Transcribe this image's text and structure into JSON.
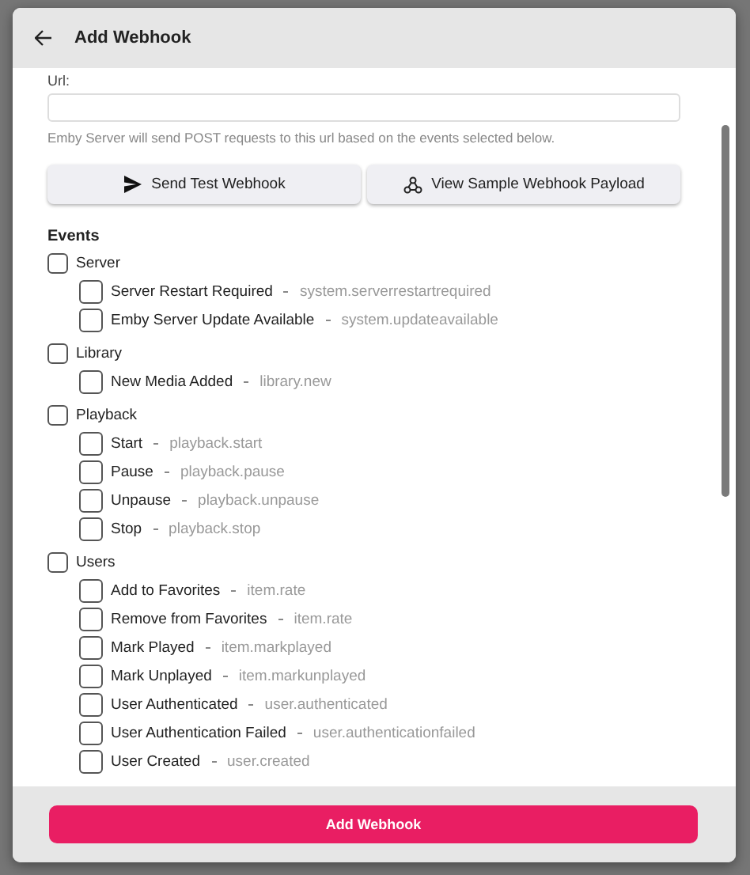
{
  "dialog": {
    "title": "Add Webhook"
  },
  "url_field": {
    "label": "Url:",
    "help": "Emby Server will send POST requests to this url based on the events selected below."
  },
  "actions": [
    {
      "kind": "send",
      "label": "Send Test Webhook"
    },
    {
      "kind": "payload",
      "label": "View Sample Webhook Payload"
    }
  ],
  "events": {
    "heading": "Events",
    "groups": [
      {
        "name": "Server",
        "checked": false,
        "children": [
          {
            "name": "Server Restart Required",
            "event": "system.serverrestartrequired",
            "checked": false
          },
          {
            "name": "Emby Server Update Available",
            "event": "system.updateavailable",
            "checked": false
          }
        ]
      },
      {
        "name": "Library",
        "checked": false,
        "children": [
          {
            "name": "New Media Added",
            "event": "library.new",
            "checked": false
          }
        ]
      },
      {
        "name": "Playback",
        "checked": false,
        "children": [
          {
            "name": "Start",
            "event": "playback.start",
            "checked": false
          },
          {
            "name": "Pause",
            "event": "playback.pause",
            "checked": false
          },
          {
            "name": "Unpause",
            "event": "playback.unpause",
            "checked": false
          },
          {
            "name": "Stop",
            "event": "playback.stop",
            "checked": false
          }
        ]
      },
      {
        "name": "Users",
        "checked": false,
        "children": [
          {
            "name": "Add to Favorites",
            "event": "item.rate",
            "checked": false
          },
          {
            "name": "Remove from Favorites",
            "event": "item.rate",
            "checked": false
          },
          {
            "name": "Mark Played",
            "event": "item.markplayed",
            "checked": false
          },
          {
            "name": "Mark Unplayed",
            "event": "item.markunplayed",
            "checked": false
          },
          {
            "name": "User Authenticated",
            "event": "user.authenticated",
            "checked": false
          },
          {
            "name": "User Authentication Failed",
            "event": "user.authenticationfailed",
            "checked": false
          },
          {
            "name": "User Created",
            "event": "user.created",
            "checked": false
          }
        ]
      }
    ]
  },
  "submit": {
    "label": "Add Webhook"
  }
}
